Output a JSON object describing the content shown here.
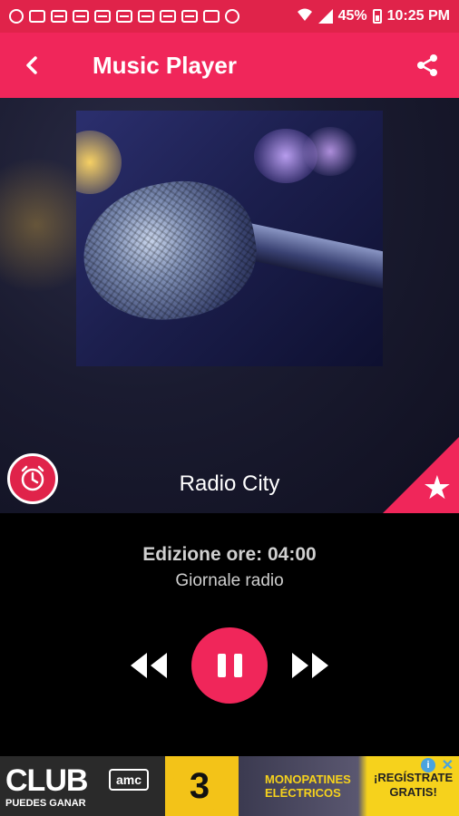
{
  "status_bar": {
    "battery": "45%",
    "time": "10:25 PM"
  },
  "app_bar": {
    "title": "Music Player",
    "back_icon": "back-arrow-icon",
    "share_icon": "share-icon"
  },
  "player": {
    "station": "Radio City",
    "edition": "Edizione ore: 04:00",
    "program": "Giornale radio",
    "is_playing": true
  },
  "ad": {
    "brand": "CLUB",
    "tagline": "PUEDES GANAR",
    "channel": "amc",
    "number": "3",
    "product_line1": "MONOPATINES",
    "product_line2": "ELÉCTRICOS",
    "cta_line1": "¡REGÍSTRATE",
    "cta_line2": "GRATIS!",
    "info": "i",
    "close": "✕"
  },
  "colors": {
    "accent": "#f0265a",
    "status_bar": "#e0234a"
  }
}
